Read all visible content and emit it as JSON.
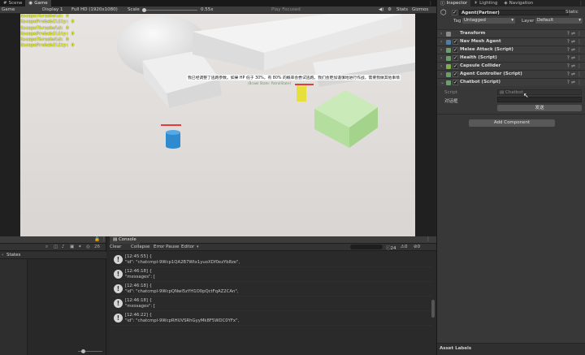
{
  "top_tabs": [
    {
      "label": "Scene",
      "icon": "grid-icon"
    },
    {
      "label": "Game",
      "icon": "gamepad-icon"
    }
  ],
  "game_toolbar": {
    "view": "Game",
    "display": "Display 1",
    "resolution": "Full HD (1920x1080)",
    "scale_label": "Scale",
    "scale_value": "0.55x",
    "play_mode": "Play Focused",
    "stats": "Stats",
    "gizmos": "Gizmos"
  },
  "debug_text": [
    "EscapeThreshold: 0",
    "EscapeProbability: 0",
    "EscapeThreshold: 0",
    "EscapeProbability: 0",
    "EscapeThreshold: 0",
    "EscapeProbability: 0"
  ],
  "scene_overlay": {
    "chat_banner": "我已经调整了逃跑参数。如果 HP 低于 30%，有 80% 的概率会尝试逃跑。我们会更加谨慎地进行作战，需要我做其他事情",
    "state_label": "(Brawl State: PatrolState)"
  },
  "bottom_left": {
    "title": "",
    "states_label": "States",
    "badge": "26"
  },
  "console": {
    "tab_label": "Console",
    "toolbar": {
      "clear": "Clear",
      "collapse": "Collapse",
      "error_pause": "Error Pause",
      "editor": "Editor"
    },
    "counts": {
      "info": "24",
      "warning": "0",
      "error": "0"
    },
    "logs": [
      {
        "line1": "[12:45:55] {",
        "line2": "\"id\": \"chatcmpl-9Wcp1QA2B7Wtx1yuoXDf0ezYb8ze\","
      },
      {
        "line1": "[12:46:18] {",
        "line2": "\"messages\": ["
      },
      {
        "line1": "[12:46:18] {",
        "line2": "\"id\": \"chatcmpl-9WcpQNwl5zYH1O0pQctFqAZ2CAn\","
      },
      {
        "line1": "[12:46:18] {",
        "line2": "\"messages\": ["
      },
      {
        "line1": "[12:46:22] {",
        "line2": "\"id\": \"chatcmpl-9WcpRHUVSRhGyyMk8F5WDC0YFx\","
      }
    ]
  },
  "inspector": {
    "tabs": [
      {
        "label": "Inspector",
        "icon": "info-icon"
      },
      {
        "label": "Lighting",
        "icon": "bulb-icon"
      },
      {
        "label": "Navigation",
        "icon": "compass-icon"
      }
    ],
    "object_name": "Agent(Partner)",
    "static_label": "Static",
    "tag_label": "Tag",
    "tag_value": "Untagged",
    "layer_label": "Layer",
    "layer_value": "Default",
    "components": [
      {
        "name": "Transform",
        "has_check": false
      },
      {
        "name": "Nav Mesh Agent",
        "has_check": true
      },
      {
        "name": "Melee Attack (Script)",
        "has_check": true
      },
      {
        "name": "Health (Script)",
        "has_check": true
      },
      {
        "name": "Capsule Collider",
        "has_check": true
      },
      {
        "name": "Agent Controller (Script)",
        "has_check": true
      },
      {
        "name": "Chatbot (Script)",
        "has_check": true
      }
    ],
    "script_label": "Script",
    "script_value": "Chatbot",
    "dialog_label": "对话框",
    "send_button": "发送",
    "add_component": "Add Component",
    "asset_labels": "Asset Labels"
  }
}
